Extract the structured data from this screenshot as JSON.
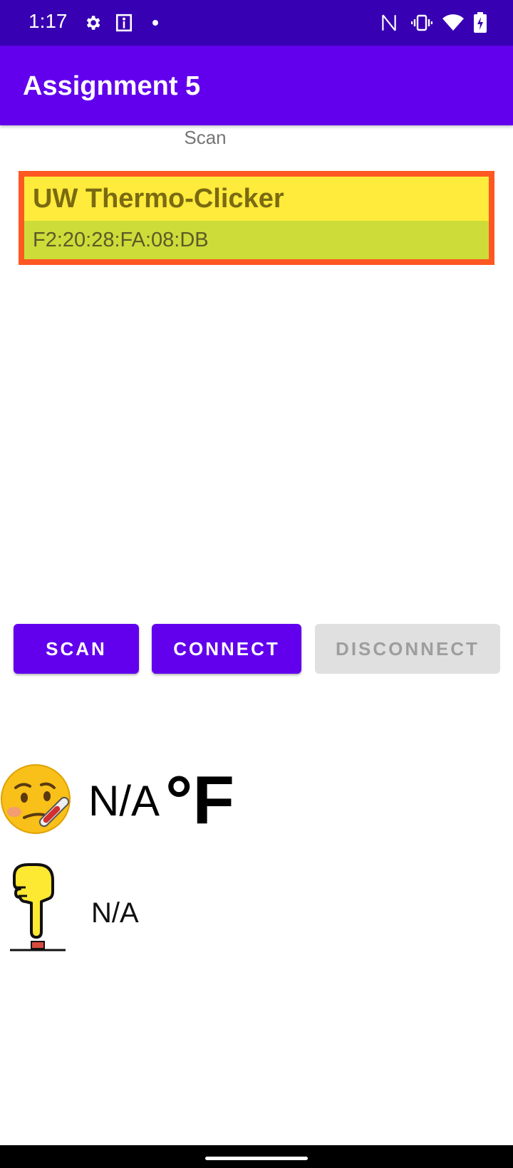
{
  "status_bar": {
    "time": "1:17",
    "icons": [
      "settings-icon",
      "accessibility-icon",
      "notification-dot-icon",
      "nfc-icon",
      "vibrate-icon",
      "wifi-icon",
      "battery-charging-icon"
    ]
  },
  "app_bar": {
    "title": "Assignment 5"
  },
  "scan_section": {
    "label": "Scan"
  },
  "device": {
    "name": "UW Thermo-Clicker",
    "address": "F2:20:28:FA:08:DB"
  },
  "buttons": {
    "scan": "SCAN",
    "connect": "CONNECT",
    "disconnect": "DISCONNECT"
  },
  "temperature": {
    "value": "N/A",
    "unit": "°F",
    "icon": "face-with-thermometer-icon"
  },
  "clicker": {
    "value": "N/A",
    "icon": "pointing-down-button-icon"
  },
  "colors": {
    "status_bar": "#3700b3",
    "app_bar": "#6200ee",
    "device_border": "#ff5722",
    "device_name_bg": "#ffeb3b",
    "device_addr_bg": "#cddc39"
  }
}
